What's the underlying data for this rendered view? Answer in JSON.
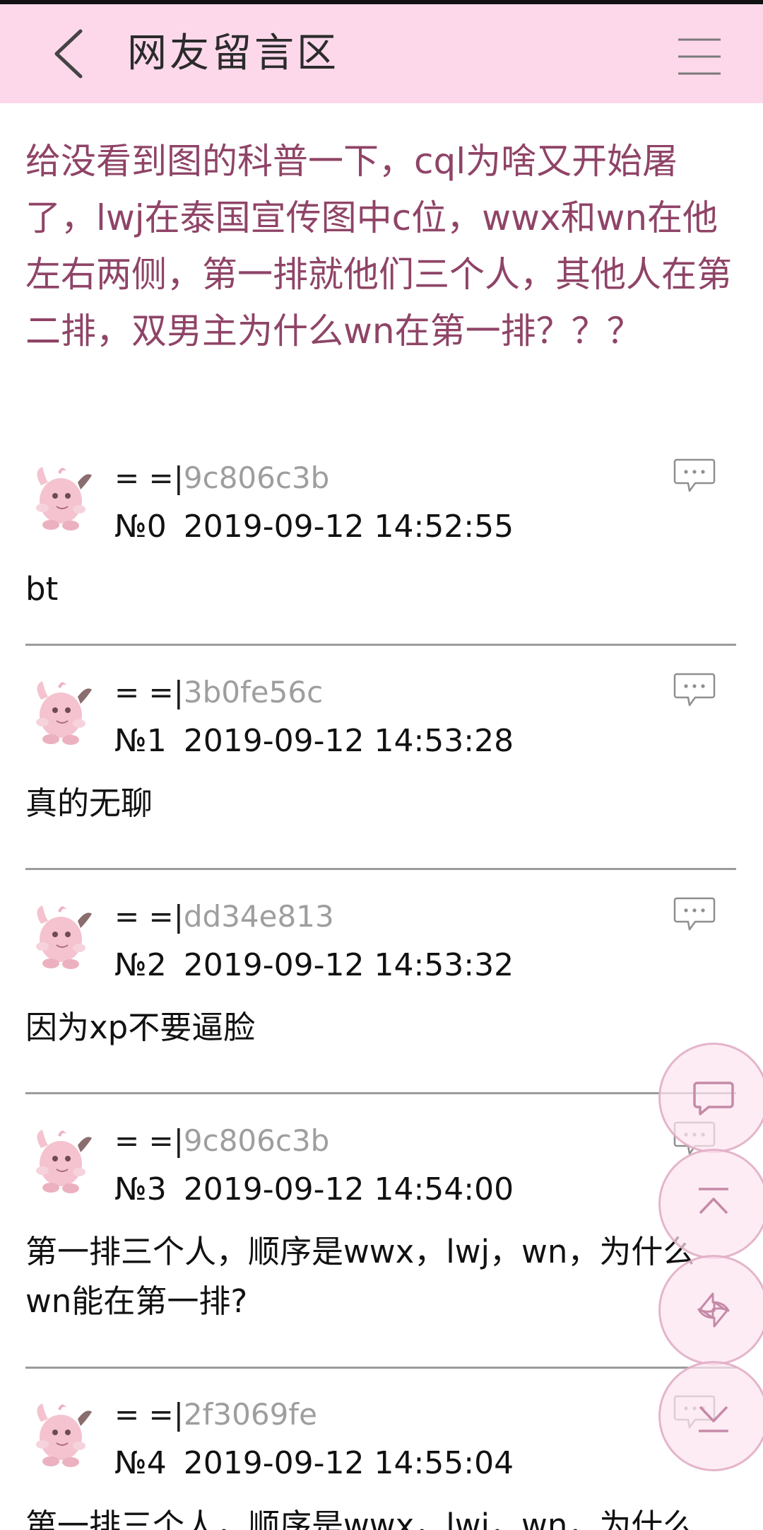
{
  "header": {
    "title": "网友留言区",
    "back_icon": "chevron-left-icon",
    "menu_icon": "hamburger-menu-icon",
    "background": "#fdd8ea"
  },
  "topic": {
    "text": "给没看到图的科普一下，cql为啥又开始屠了，lwj在泰国宣传图中c位，wwx和wn在他左右两侧，第一排就他们三个人，其他人在第二排，双男主为什么wn在第一排？？？",
    "color": "#8f4467"
  },
  "posts": [
    {
      "name_prefix": "= =|",
      "uid": "9c806c3b",
      "floor": "№0",
      "timestamp": "2019-09-12 14:52:55",
      "content": "bt"
    },
    {
      "name_prefix": "= =|",
      "uid": "3b0fe56c",
      "floor": "№1",
      "timestamp": "2019-09-12 14:53:28",
      "content": "真的无聊"
    },
    {
      "name_prefix": "= =|",
      "uid": "dd34e813",
      "floor": "№2",
      "timestamp": "2019-09-12 14:53:32",
      "content": "因为xp不要逼脸"
    },
    {
      "name_prefix": "= =|",
      "uid": "9c806c3b",
      "floor": "№3",
      "timestamp": "2019-09-12 14:54:00",
      "content": "第一排三个人，顺序是wwx，lwj，wn，为什么wn能在第一排?"
    },
    {
      "name_prefix": "= =|",
      "uid": "2f3069fe",
      "floor": "№4",
      "timestamp": "2019-09-12 14:55:04",
      "content": "第一排三个人，顺序是wwx，lwj，wn，为什么"
    }
  ],
  "icons": {
    "avatar": "pink-creature-avatar-icon",
    "reply": "comment-bubble-icon"
  },
  "fabs": [
    {
      "name": "comment-fab",
      "icon": "speech-bubble-icon"
    },
    {
      "name": "scroll-top-fab",
      "icon": "scroll-to-top-icon"
    },
    {
      "name": "refresh-fab",
      "icon": "refresh-icon"
    },
    {
      "name": "scroll-bottom-fab",
      "icon": "scroll-to-bottom-icon"
    }
  ]
}
